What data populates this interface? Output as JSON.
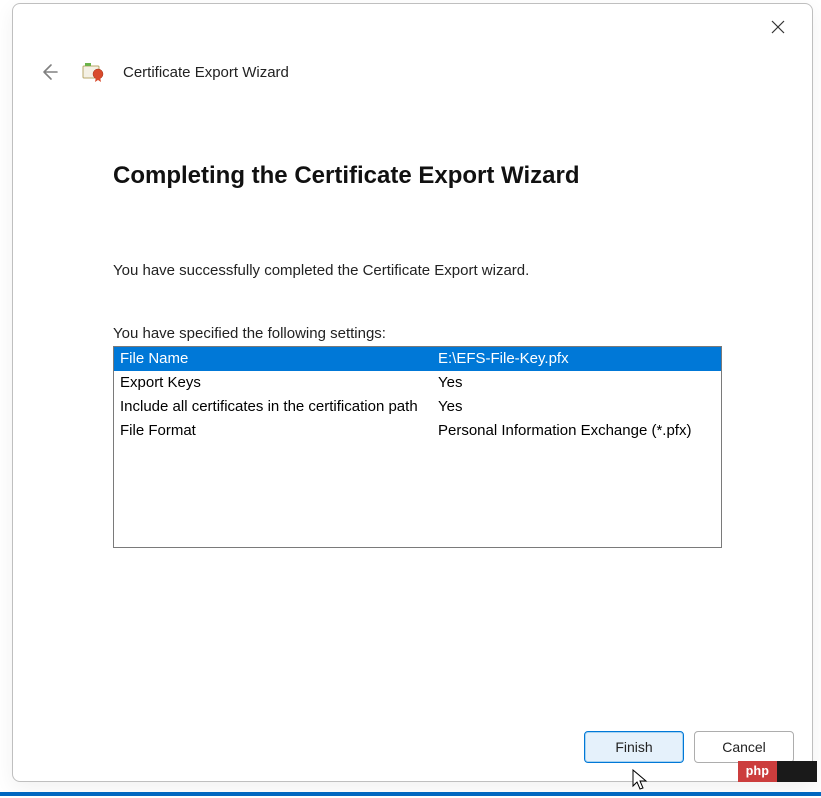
{
  "window": {
    "title": "Certificate Export Wizard"
  },
  "content": {
    "heading": "Completing the Certificate Export Wizard",
    "success_text": "You have successfully completed the Certificate Export wizard.",
    "settings_label": "You have specified the following settings:"
  },
  "settings": {
    "rows": [
      {
        "key": "File Name",
        "value": "E:\\EFS-File-Key.pfx",
        "selected": true
      },
      {
        "key": "Export Keys",
        "value": "Yes",
        "selected": false
      },
      {
        "key": "Include all certificates in the certification path",
        "value": "Yes",
        "selected": false
      },
      {
        "key": "File Format",
        "value": "Personal Information Exchange (*.pfx)",
        "selected": false
      }
    ]
  },
  "footer": {
    "finish_label": "Finish",
    "cancel_label": "Cancel"
  },
  "watermark": {
    "text": "php"
  }
}
